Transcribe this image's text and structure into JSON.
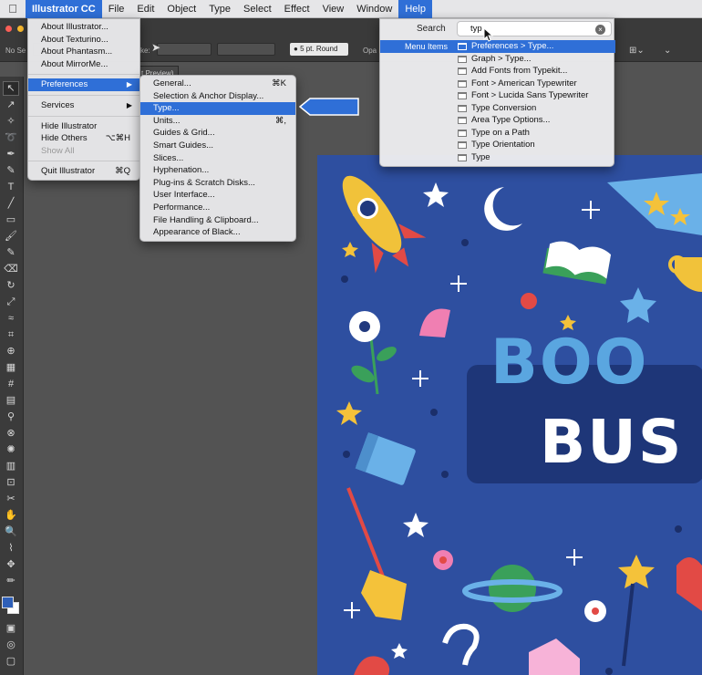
{
  "menubar": {
    "apple": "",
    "items": [
      "Illustrator CC",
      "File",
      "Edit",
      "Object",
      "Type",
      "Select",
      "Effect",
      "View",
      "Window",
      "Help"
    ]
  },
  "controlbar": {
    "no_sel_label": "No Se",
    "stroke_label": "ke:",
    "brush_label": "5 pt. Round",
    "opacity_label": "Opa",
    "doc_tab": "t Preview)"
  },
  "app_menu": {
    "items": [
      {
        "label": "About Illustrator...",
        "shortcut": ""
      },
      {
        "label": "About Texturino...",
        "shortcut": ""
      },
      {
        "label": "About Phantasm...",
        "shortcut": ""
      },
      {
        "label": "About MirrorMe...",
        "shortcut": ""
      },
      {
        "label": "Preferences",
        "shortcut": "▶"
      },
      {
        "label": "Services",
        "shortcut": "▶"
      },
      {
        "label": "Hide Illustrator",
        "shortcut": ""
      },
      {
        "label": "Hide Others",
        "shortcut": "⌥⌘H"
      },
      {
        "label": "Show All",
        "shortcut": ""
      },
      {
        "label": "Quit Illustrator",
        "shortcut": "⌘Q"
      }
    ]
  },
  "prefs_menu": {
    "items": [
      {
        "label": "General...",
        "shortcut": "⌘K"
      },
      {
        "label": "Selection & Anchor Display...",
        "shortcut": ""
      },
      {
        "label": "Type...",
        "shortcut": ""
      },
      {
        "label": "Units...",
        "shortcut": "⌘,"
      },
      {
        "label": "Guides & Grid...",
        "shortcut": ""
      },
      {
        "label": "Smart Guides...",
        "shortcut": ""
      },
      {
        "label": "Slices...",
        "shortcut": ""
      },
      {
        "label": "Hyphenation...",
        "shortcut": ""
      },
      {
        "label": "Plug-ins & Scratch Disks...",
        "shortcut": ""
      },
      {
        "label": "User Interface...",
        "shortcut": ""
      },
      {
        "label": "Performance...",
        "shortcut": ""
      },
      {
        "label": "File Handling & Clipboard...",
        "shortcut": ""
      },
      {
        "label": "Appearance of Black...",
        "shortcut": ""
      }
    ]
  },
  "help": {
    "search_label": "Search",
    "search_value": "typ",
    "menu_items_label": "Menu Items",
    "results": [
      "Preferences > Type...",
      "Graph > Type...",
      "Add Fonts from Typekit...",
      "Font > American Typewriter",
      "Font > Lucida Sans Typewriter",
      "Type Conversion",
      "Area Type Options...",
      "Type on a Path",
      "Type Orientation",
      "Type"
    ]
  },
  "artboard": {
    "title_line1": "BOO",
    "title_line2": "BUS"
  },
  "colors": {
    "accent": "#2f6fd7",
    "artboard_bg": "#2e4fa0",
    "title_blue": "#5aa6e0",
    "title_yellow": "#f4c23a"
  }
}
